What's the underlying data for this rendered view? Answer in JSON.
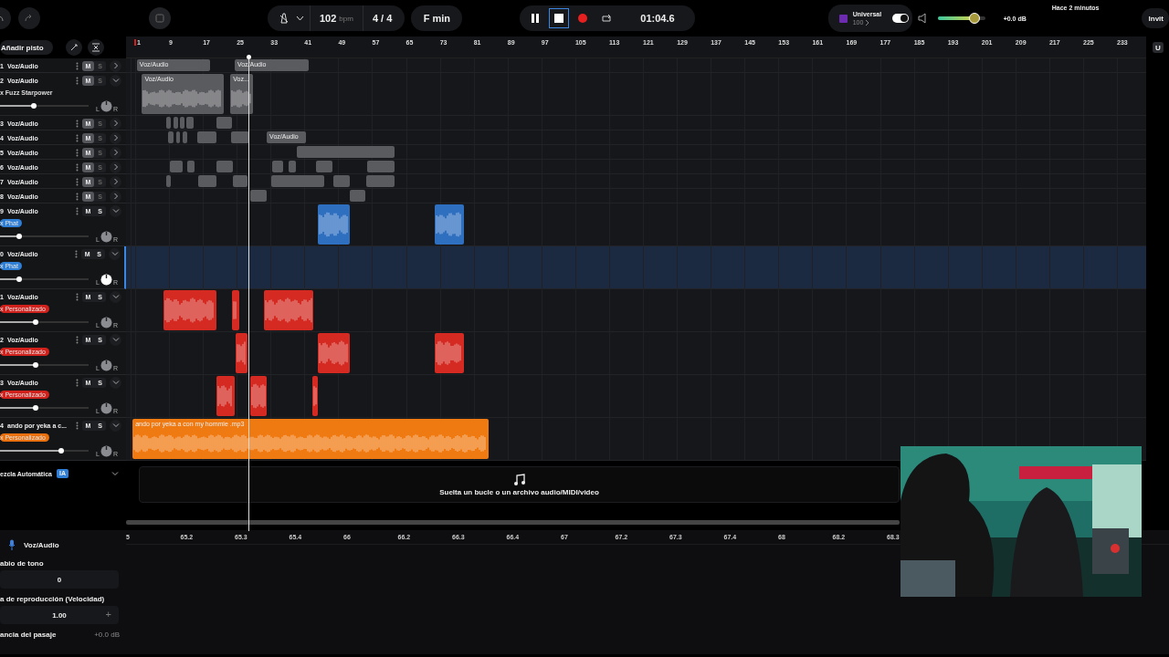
{
  "toolbar": {
    "bpm": "102",
    "bpm_unit": "bpm",
    "time_signature": "4 / 4",
    "key": "F min",
    "transport": [
      {
        "kind": "pause",
        "selected": false
      },
      {
        "kind": "stop",
        "selected": true
      },
      {
        "kind": "record",
        "selected": false
      },
      {
        "kind": "loop",
        "selected": false
      }
    ],
    "time": "01:04.6",
    "preset": {
      "name": "Universal",
      "value": "100"
    },
    "monitor_on": true,
    "volume": {
      "level": 0.8
    },
    "gain": "+0.0 dB",
    "saved": "Hace 2 minutos",
    "invite": "Invit"
  },
  "sidebar": {
    "add_track": "Añadir pisto"
  },
  "ruler": {
    "bars": [
      "1",
      "9",
      "17",
      "25",
      "33",
      "41",
      "49",
      "57",
      "65",
      "73",
      "81",
      "89",
      "97",
      "105",
      "113",
      "121",
      "129",
      "137",
      "145",
      "153",
      "161",
      "169",
      "177",
      "185",
      "193",
      "201",
      "209",
      "217",
      "225",
      "233"
    ],
    "scroll_button": "U"
  },
  "tracks": [
    {
      "number": "1",
      "name": "Voz/Audio",
      "mute_label": "M",
      "solo_label": "S",
      "muted": true,
      "expanded": false,
      "selected": false,
      "color": "#5a5b5f",
      "clips": [
        {
          "label": "Voz/Audio"
        },
        {
          "label": "Voz/Audio"
        }
      ]
    },
    {
      "number": "2",
      "name": "Voz/Audio",
      "mute_label": "M",
      "solo_label": "S",
      "muted": true,
      "expanded": true,
      "selected": false,
      "color": "#5a5b5f",
      "effect": {
        "label": "x Fuzz Starpower"
      },
      "level": 0.38,
      "pan_left": "L",
      "pan_right": "R",
      "clips": [
        {
          "label": "Voz/Audio"
        },
        {
          "label": "Voz..."
        }
      ]
    },
    {
      "number": "3",
      "name": "Voz/Audio",
      "mute_label": "M",
      "solo_label": "S",
      "muted": true,
      "expanded": false,
      "selected": false,
      "color": "#5a5b5f"
    },
    {
      "number": "4",
      "name": "Voz/Audio",
      "mute_label": "M",
      "solo_label": "S",
      "muted": true,
      "expanded": false,
      "selected": false,
      "color": "#5a5b5f",
      "clips": [
        {
          "label": "Voz/Audio"
        }
      ]
    },
    {
      "number": "5",
      "name": "Voz/Audio",
      "mute_label": "M",
      "solo_label": "S",
      "muted": true,
      "expanded": false,
      "selected": false,
      "color": "#5a5b5f"
    },
    {
      "number": "6",
      "name": "Voz/Audio",
      "mute_label": "M",
      "solo_label": "S",
      "muted": true,
      "expanded": false,
      "selected": false,
      "color": "#5a5b5f"
    },
    {
      "number": "7",
      "name": "Voz/Audio",
      "mute_label": "M",
      "solo_label": "S",
      "muted": true,
      "expanded": false,
      "selected": false,
      "color": "#5a5b5f"
    },
    {
      "number": "8",
      "name": "Voz/Audio",
      "mute_label": "M",
      "solo_label": "S",
      "muted": true,
      "expanded": false,
      "selected": false,
      "color": "#5a5b5f"
    },
    {
      "number": "9",
      "name": "Voz/Audio",
      "mute_label": "M",
      "solo_label": "S",
      "muted": false,
      "expanded": true,
      "selected": false,
      "color": "#2f6fc0",
      "effect": {
        "label": "x Phat",
        "color": "#2f7fd6"
      },
      "level": 0.22,
      "pan_left": "L",
      "pan_right": "R"
    },
    {
      "number": "0",
      "name": "Voz/Audio",
      "mute_label": "M",
      "solo_label": "S",
      "muted": false,
      "expanded": true,
      "selected": true,
      "effect": {
        "label": "x Phat",
        "color": "#2f7fd6"
      },
      "level": 0.22,
      "pan_left": "L",
      "pan_right": "R"
    },
    {
      "number": "1",
      "name": "Voz/Audio",
      "mute_label": "M",
      "solo_label": "S",
      "muted": false,
      "expanded": true,
      "selected": false,
      "color": "#d42a22",
      "effect": {
        "label": "x Personalizado",
        "color": "#d0211c"
      },
      "level": 0.4,
      "pan_left": "L",
      "pan_right": "R"
    },
    {
      "number": "2",
      "name": "Voz/Audio",
      "mute_label": "M",
      "solo_label": "S",
      "muted": false,
      "expanded": true,
      "selected": false,
      "color": "#d42a22",
      "effect": {
        "label": "x Personalizado",
        "color": "#d0211c"
      },
      "level": 0.4,
      "pan_left": "L",
      "pan_right": "R"
    },
    {
      "number": "3",
      "name": "Voz/Audio",
      "mute_label": "M",
      "solo_label": "S",
      "muted": false,
      "expanded": true,
      "selected": false,
      "color": "#d42a22",
      "effect": {
        "label": "x Personalizado",
        "color": "#d0211c"
      },
      "level": 0.4,
      "pan_left": "L",
      "pan_right": "R"
    },
    {
      "number": "4",
      "name": "ando por yeka a c...",
      "mute_label": "M",
      "solo_label": "S",
      "muted": false,
      "expanded": true,
      "selected": false,
      "color": "#f07a12",
      "effect": {
        "label": "x Personalizado",
        "color": "#e8700f"
      },
      "level": 0.69,
      "pan_left": "L",
      "pan_right": "R",
      "clips": [
        {
          "label": "ando por yeka a con my hommie .mp3"
        }
      ]
    }
  ],
  "auto_mix": {
    "label": "ezcla Automática",
    "badge": "IA"
  },
  "drop_hint": "Suelta un bucle o un archivo audio/MIDI/video",
  "editor": {
    "track": "Voz/Audio",
    "fields": [
      {
        "kind": "field",
        "label": "abio de tono",
        "value": "0"
      },
      {
        "kind": "stepper",
        "label": "a de reproducción (Velocidad)",
        "value": "1.00",
        "step": "+"
      },
      {
        "kind": "readout",
        "label": "ancia del pasaje",
        "value": "+0.0 dB"
      }
    ]
  },
  "zoom_ruler": [
    "5",
    "65.2",
    "65.3",
    "65.4",
    "66",
    "66.2",
    "66.3",
    "66.4",
    "67",
    "67.2",
    "67.3",
    "67.4",
    "68",
    "68.2",
    "68.3"
  ]
}
